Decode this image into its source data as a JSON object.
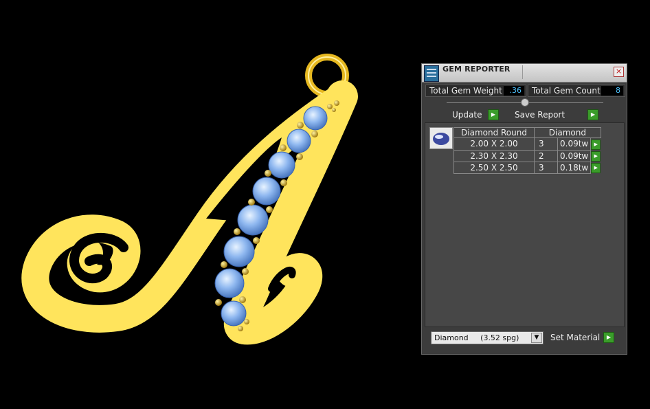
{
  "panel": {
    "title": "GEM REPORTER",
    "close_label": "×",
    "total_weight_label": "Total Gem Weight",
    "total_weight_value": ".36",
    "total_count_label": "Total Gem Count",
    "total_count_value": "8",
    "update_label": "Update",
    "save_report_label": "Save Report",
    "table": {
      "header_shape": "Diamond Round",
      "header_material": "Diamond",
      "rows": [
        {
          "size": "2.00 X 2.00",
          "count": "3",
          "weight": "0.09tw"
        },
        {
          "size": "2.30 X 2.30",
          "count": "2",
          "weight": "0.09tw"
        },
        {
          "size": "2.50 X 2.50",
          "count": "3",
          "weight": "0.18tw"
        }
      ]
    },
    "material_select": "Diamond     (3.52 spg)",
    "set_material_label": "Set Material",
    "go_glyph": "▶",
    "dropdown_glyph": "▼"
  },
  "colors": {
    "gold": "#ffe45c",
    "gold_dark": "#d9b020",
    "gem": "#8fb8f0",
    "value_text": "#4ec3ff",
    "go_button": "#3a9c2a"
  },
  "icons": [
    "app-icon",
    "close-icon",
    "slider-knob",
    "go-arrow-icon",
    "dropdown-arrow-icon",
    "gem-thumbnail-icon"
  ]
}
